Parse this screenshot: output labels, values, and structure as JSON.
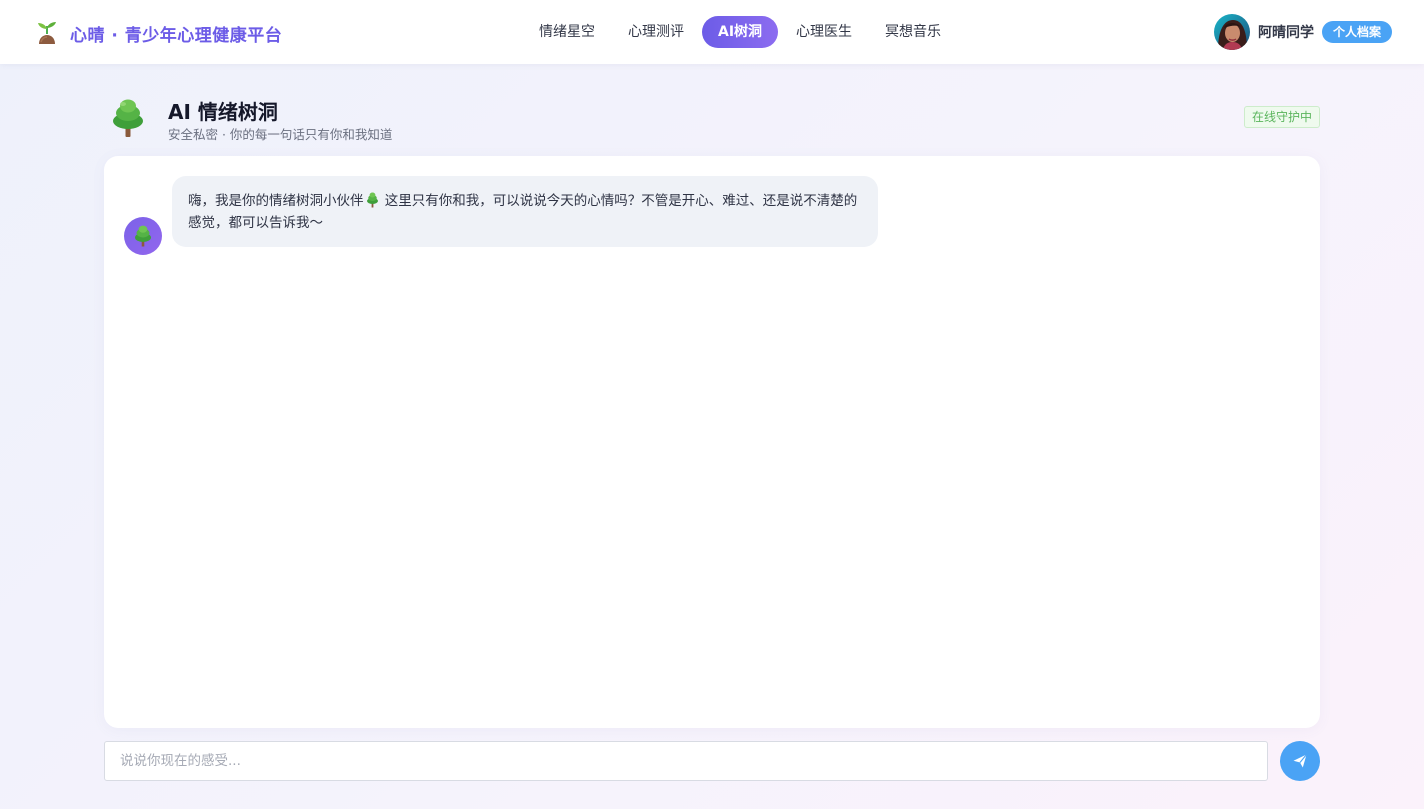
{
  "header": {
    "brand_title": "心晴 · 青少年心理健康平台",
    "brand_icon": "seedling-icon",
    "nav": [
      {
        "label": "情绪星空",
        "active": false
      },
      {
        "label": "心理测评",
        "active": false
      },
      {
        "label": "AI树洞",
        "active": true
      },
      {
        "label": "心理医生",
        "active": false
      },
      {
        "label": "冥想音乐",
        "active": false
      }
    ],
    "user": {
      "name": "阿晴同学",
      "profile_button": "个人档案"
    }
  },
  "page": {
    "icon": "tree-icon",
    "title": "AI 情绪树洞",
    "subtitle": "安全私密 · 你的每一句话只有你和我知道",
    "status": "在线守护中"
  },
  "chat": {
    "messages": [
      {
        "sender": "bot",
        "text_before_icon": "嗨，我是你的情绪树洞小伙伴",
        "text_after_icon": " 这里只有你和我，可以说说今天的心情吗？不管是开心、难过、还是说不清楚的感觉，都可以告诉我～"
      }
    ]
  },
  "composer": {
    "placeholder": "说说你现在的感受...",
    "value": ""
  },
  "colors": {
    "brand": "#6c5ce7",
    "accent_blue": "#4aa3f5",
    "status_green": "#5bb55d",
    "bubble_bg": "#eff2f7"
  }
}
